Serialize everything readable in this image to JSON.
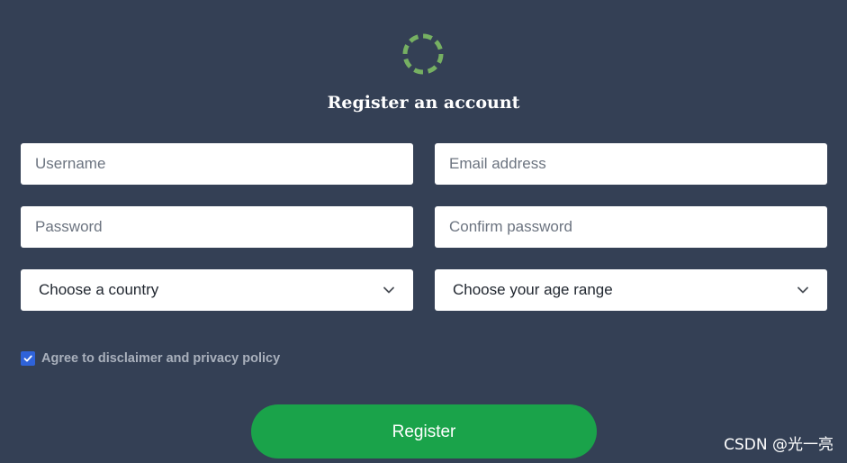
{
  "logo": {
    "icon": "dashed-circle-icon",
    "colors": [
      "#6aa85a",
      "#8fc47a"
    ]
  },
  "form": {
    "title": "Register an account",
    "username_placeholder": "Username",
    "email_placeholder": "Email address",
    "password_placeholder": "Password",
    "confirm_password_placeholder": "Confirm password",
    "country_select": {
      "selected": "Choose a country",
      "icon": "chevron-down-icon"
    },
    "age_select": {
      "selected": "Choose your age range",
      "icon": "chevron-down-icon"
    },
    "agree": {
      "checked": true,
      "label": "Agree to disclaimer and privacy policy"
    },
    "register_label": "Register"
  },
  "watermark": "CSDN @光一亮",
  "colors": {
    "background": "#344055",
    "accent_green": "#1aa34a",
    "checkbox_blue": "#2f63d9",
    "field_bg": "#ffffff"
  }
}
